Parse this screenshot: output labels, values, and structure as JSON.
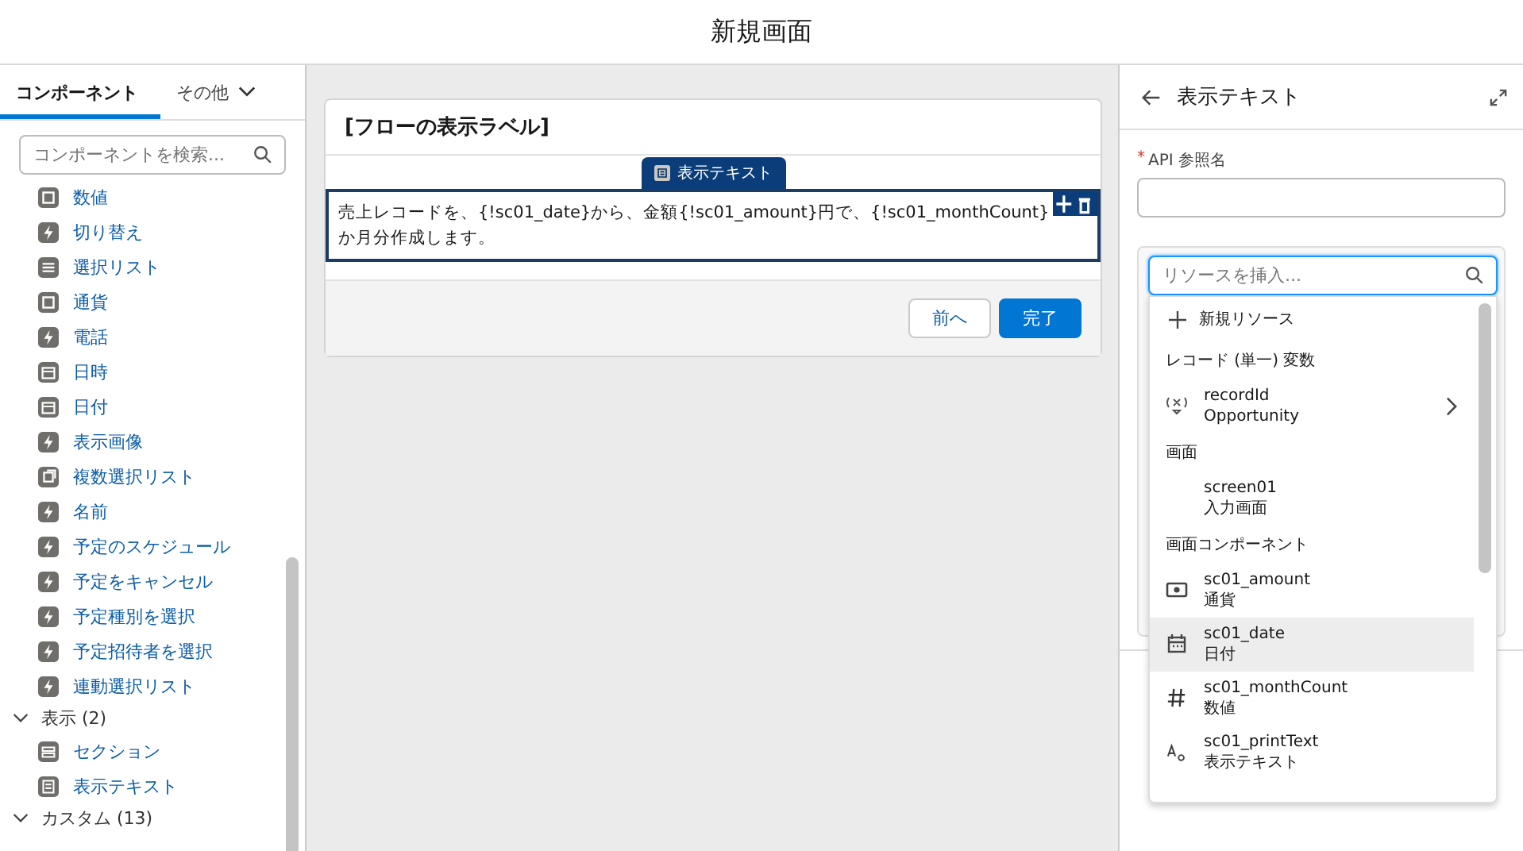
{
  "header": {
    "title": "新規画面"
  },
  "palette": {
    "tabs": [
      {
        "label": "コンポーネント",
        "selected": true,
        "dropdown": false
      },
      {
        "label": "その他",
        "selected": false,
        "dropdown": true
      }
    ],
    "search": {
      "placeholder": "コンポーネントを検索..."
    },
    "items": [
      {
        "kind": "number",
        "label": "数値"
      },
      {
        "kind": "bolt",
        "label": "切り替え"
      },
      {
        "kind": "list",
        "label": "選択リスト"
      },
      {
        "kind": "currency",
        "label": "通貨"
      },
      {
        "kind": "bolt",
        "label": "電話"
      },
      {
        "kind": "datetime",
        "label": "日時"
      },
      {
        "kind": "date",
        "label": "日付"
      },
      {
        "kind": "bolt",
        "label": "表示画像"
      },
      {
        "kind": "multi",
        "label": "複数選択リスト"
      },
      {
        "kind": "bolt",
        "label": "名前"
      },
      {
        "kind": "bolt",
        "label": "予定のスケジュール"
      },
      {
        "kind": "bolt",
        "label": "予定をキャンセル"
      },
      {
        "kind": "bolt",
        "label": "予定種別を選択"
      },
      {
        "kind": "bolt",
        "label": "予定招待者を選択"
      },
      {
        "kind": "bolt",
        "label": "連動選択リスト"
      },
      {
        "kind": "group",
        "label": "表示 (2)",
        "expanded": true
      },
      {
        "kind": "section",
        "label": "セクション"
      },
      {
        "kind": "text",
        "label": "表示テキスト"
      },
      {
        "kind": "group",
        "label": "カスタム (13)",
        "expanded": true
      }
    ]
  },
  "canvas": {
    "screen_title": "[フローの表示ラベル]",
    "component_tag": "表示テキスト",
    "display_text": "売上レコードを、{!sc01_date}から、金額{!sc01_amount}円で、{!sc01_monthCount}か月分作成します。",
    "buttons": [
      {
        "label": "前へ",
        "primary": false
      },
      {
        "label": "完了",
        "primary": true
      }
    ]
  },
  "properties": {
    "title": "表示テキスト",
    "required_mark": "*",
    "api_name_label": "API 参照名",
    "resource_search": {
      "placeholder": "リソースを挿入..."
    },
    "dropdown": [
      {
        "kind": "action",
        "label": "新規リソース"
      },
      {
        "kind": "header",
        "label": "レコード (単一) 変数"
      },
      {
        "kind": "variable",
        "name": "recordId",
        "type": "Opportunity",
        "has_children": true,
        "selected": false
      },
      {
        "kind": "header",
        "label": "画面"
      },
      {
        "kind": "screen",
        "name": "screen01",
        "type": "入力画面",
        "has_children": false,
        "selected": false
      },
      {
        "kind": "header",
        "label": "画面コンポーネント"
      },
      {
        "kind": "currency",
        "name": "sc01_amount",
        "type": "通貨",
        "has_children": false,
        "selected": false
      },
      {
        "kind": "calendar",
        "name": "sc01_date",
        "type": "日付",
        "has_children": false,
        "selected": true
      },
      {
        "kind": "hash",
        "name": "sc01_monthCount",
        "type": "数値",
        "has_children": false,
        "selected": false
      },
      {
        "kind": "aa",
        "name": "sc01_printText",
        "type": "表示テキスト",
        "has_children": false,
        "selected": false
      }
    ]
  }
}
